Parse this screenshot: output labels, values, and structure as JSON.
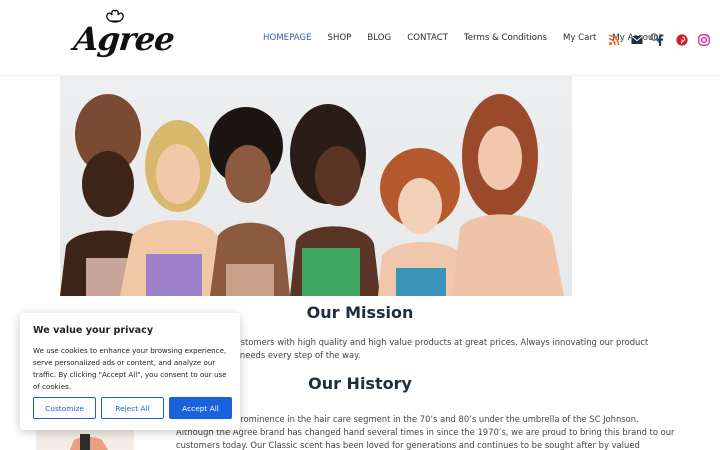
{
  "brand": {
    "logo_text": "Agree"
  },
  "nav": {
    "items": [
      {
        "label": "HOMEPAGE",
        "active": true
      },
      {
        "label": "SHOP"
      },
      {
        "label": "BLOG"
      },
      {
        "label": "CONTACT"
      },
      {
        "label": "Terms & Conditions"
      },
      {
        "label": "My Cart"
      },
      {
        "label": "My Account"
      }
    ]
  },
  "header_icons": [
    "search-icon",
    "rss-icon",
    "mail-icon",
    "facebook-icon",
    "pinterest-icon",
    "instagram-icon"
  ],
  "colors": {
    "accent": "#1863dc",
    "nav_active": "#3a5fae",
    "heading": "#1f2d3d",
    "pinterest": "#cb2027",
    "instagram": "#d6249f",
    "rss": "#f26522"
  },
  "mission": {
    "heading": "Our Mission",
    "text": "Agree provides customers with high quality and high value products at great prices. Always innovating our product expectations and needs every step of the way."
  },
  "history": {
    "heading": "Our History",
    "text": "Agree rose to prominence in the hair care segment in the 70’s and 80’s under the umbrella of the SC Johnson. Although the Agree brand has changed hand several times in since the 1970’s, we are proud to bring this brand to our customers today. Our Classic scent has been loved for generations and continues to be sought after by valued customers."
  },
  "cookie": {
    "title": "We value your privacy",
    "text": "We use cookies to enhance your browsing experience, serve personalized ads or content, and analyze our traffic. By clicking \"Accept All\", you consent to our use of cookies.",
    "customize_label": "Customize",
    "reject_label": "Reject All",
    "accept_label": "Accept All"
  }
}
